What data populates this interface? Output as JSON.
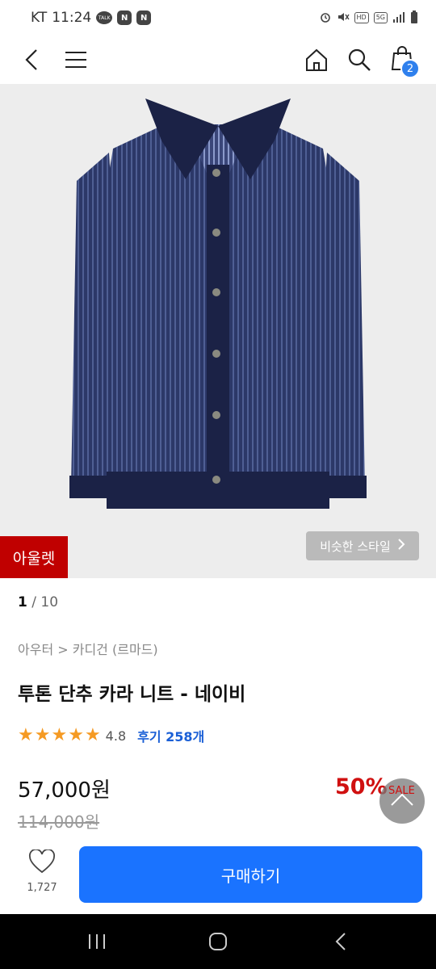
{
  "status_bar": {
    "carrier": "KT",
    "time": "11:24",
    "notification_icons": [
      "talk-icon",
      "naver-icon",
      "naver-icon"
    ],
    "talk_text": "TALK",
    "naver_text": "N",
    "hd_text": "HD",
    "network_text": "5G"
  },
  "header": {
    "cart_count": "2",
    "icons": [
      "back-icon",
      "menu-icon",
      "home-icon",
      "search-icon",
      "cart-icon"
    ]
  },
  "product_image": {
    "badge": "아울렛",
    "similar_style_label": "비슷한 스타일",
    "current_index": "1",
    "total": "/ 10",
    "colors": {
      "background": "#ededed",
      "knit": "#2e3a68",
      "trim": "#1b2246"
    }
  },
  "product": {
    "breadcrumb": "아우터 > 카디건 (르마드)",
    "title": "투톤 단추 카라 니트 - 네이비",
    "rating": 4.8,
    "rating_text": "4.8",
    "review_label": "후기 258개",
    "price": "57,000원",
    "original_price": "114,000원",
    "discount": "50%",
    "sale_label": "SALE"
  },
  "purchase_bar": {
    "like_count": "1,727",
    "buy_label": "구매하기",
    "colors": {
      "buy_button": "#1a73ff"
    }
  },
  "colors": {
    "outlet_badge": "#c00000",
    "discount": "#d01010",
    "review_link": "#1a5fd6",
    "star": "#f59a23"
  },
  "system_nav": {
    "icons": [
      "recent-apps-icon",
      "home-nav-icon",
      "back-nav-icon"
    ]
  }
}
